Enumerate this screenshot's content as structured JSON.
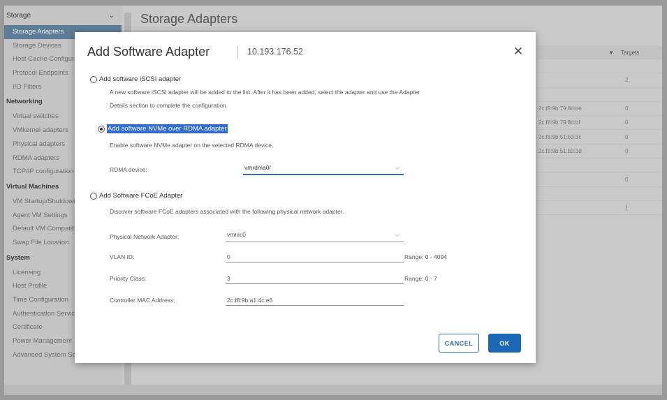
{
  "sidebar": {
    "header": "Storage",
    "sections": [
      {
        "title": "",
        "items": [
          {
            "label": "Storage Adapters",
            "active": true
          },
          {
            "label": "Storage Devices"
          },
          {
            "label": "Host Cache Configuration"
          },
          {
            "label": "Protocol Endpoints"
          },
          {
            "label": "I/O Filters"
          }
        ]
      },
      {
        "title": "Networking",
        "items": [
          {
            "label": "Virtual switches"
          },
          {
            "label": "VMkernel adapters"
          },
          {
            "label": "Physical adapters"
          },
          {
            "label": "RDMA adapters"
          },
          {
            "label": "TCP/IP configuration"
          }
        ]
      },
      {
        "title": "Virtual Machines",
        "items": [
          {
            "label": "VM Startup/Shutdown"
          },
          {
            "label": "Agent VM Settings"
          },
          {
            "label": "Default VM Compatibility"
          },
          {
            "label": "Swap File Location"
          }
        ]
      },
      {
        "title": "System",
        "items": [
          {
            "label": "Licensing"
          },
          {
            "label": "Host Profile"
          },
          {
            "label": "Time Configuration"
          },
          {
            "label": "Authentication Services"
          },
          {
            "label": "Certificate"
          },
          {
            "label": "Power Management"
          },
          {
            "label": "Advanced System Settings"
          }
        ]
      }
    ]
  },
  "page": {
    "title": "Storage Adapters",
    "table": {
      "header": "Targets",
      "rows": [
        {
          "a": "",
          "b": ""
        },
        {
          "a": "",
          "b": "2"
        },
        {
          "a": "",
          "b": ""
        },
        {
          "a": "2c:f8:9b:79:8d:be",
          "b": "0"
        },
        {
          "a": "2c:f8:9b:79:8d:bf",
          "b": "0"
        },
        {
          "a": "2c:f8:9b:51:b3:3c",
          "b": "0"
        },
        {
          "a": "2c:f8:9b:51:b3:3d",
          "b": "0"
        },
        {
          "a": "",
          "b": ""
        },
        {
          "a": "",
          "b": "0"
        },
        {
          "a": "",
          "b": ""
        },
        {
          "a": "",
          "b": "1"
        }
      ]
    }
  },
  "modal": {
    "title": "Add Software Adapter",
    "host": "10.193.176.52",
    "options": {
      "iscsi": {
        "label": "Add software iSCSI adapter",
        "desc1": "A new software iSCSI adapter will be added to the list. After it has been added, select the adapter and use the Adapter",
        "desc2": "Details section to complete the configuration."
      },
      "nvme": {
        "label": "Add software NVMe over RDMA adapter",
        "desc": "Enable software NVMe adapter on the selected RDMA device.",
        "rdma_label": "RDMA device:",
        "rdma_value": "vmrdma0/"
      },
      "fcoe": {
        "label": "Add Software FCoE Adapter",
        "desc": "Discover software FCoE adapters associated with the following physical network adapter.",
        "pna_label": "Physical Network Adapter:",
        "pna_value": "vmnic0",
        "vlan_label": "VLAN ID:",
        "vlan_value": "0",
        "vlan_range": "Range: 0 - 4094",
        "priority_label": "Priority Class:",
        "priority_value": "3",
        "priority_range": "Range: 0 - 7",
        "mac_label": "Controller MAC Address:",
        "mac_value": "2c:f8:9b:a1:4c:e6"
      }
    },
    "selected_option": "nvme",
    "cancel_label": "CANCEL",
    "ok_label": "OK"
  }
}
